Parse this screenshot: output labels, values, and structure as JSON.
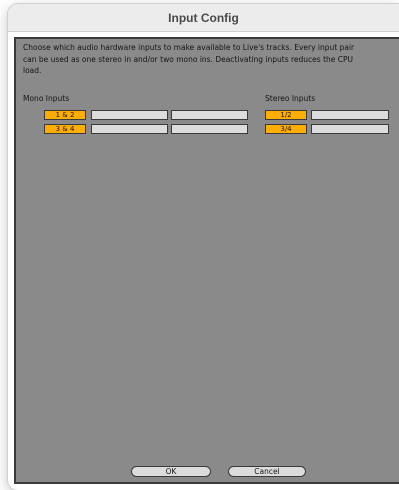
{
  "window": {
    "title": "Input Config"
  },
  "description": "Choose which audio hardware inputs to make available to Live's tracks. Every input pair can be used as one stereo in and/or two mono ins.  Deactivating inputs reduces the CPU load.",
  "mono": {
    "label": "Mono Inputs",
    "pairs": [
      {
        "label": "1 & 2",
        "active": true
      },
      {
        "label": "3 & 4",
        "active": true
      }
    ]
  },
  "stereo": {
    "label": "Stereo Inputs",
    "pairs": [
      {
        "label": "1/2",
        "active": true
      },
      {
        "label": "3/4",
        "active": true
      }
    ]
  },
  "buttons": {
    "ok": "OK",
    "cancel": "Cancel"
  },
  "colors": {
    "active": "#ffae00",
    "inactive": "#dcdcdc",
    "panel": "#8a8a8a"
  }
}
